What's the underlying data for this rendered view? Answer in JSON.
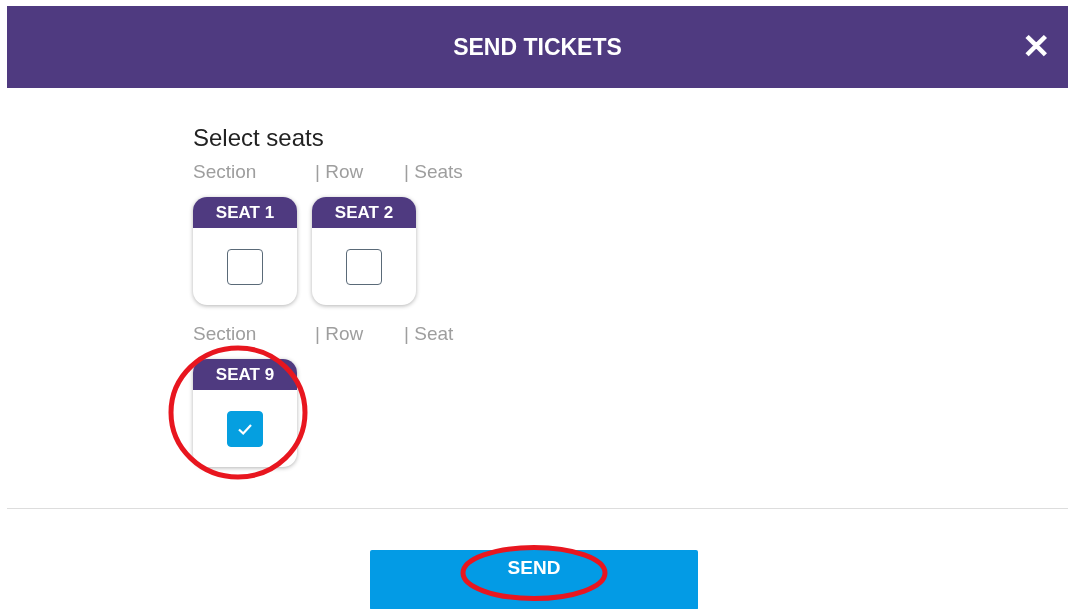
{
  "dialog": {
    "title": "SEND TICKETS",
    "close": "✕"
  },
  "heading": "Select seats",
  "groups": [
    {
      "labels": [
        "Section",
        "| Row",
        "| Seats"
      ],
      "seats": [
        {
          "label": "SEAT 1",
          "checked": false,
          "circled": false
        },
        {
          "label": "SEAT 2",
          "checked": false,
          "circled": false
        }
      ]
    },
    {
      "labels": [
        "Section",
        "| Row",
        "| Seat"
      ],
      "seats": [
        {
          "label": "SEAT 9",
          "checked": true,
          "circled": true
        }
      ]
    }
  ],
  "send_button": {
    "label": "SEND",
    "circled": true
  }
}
